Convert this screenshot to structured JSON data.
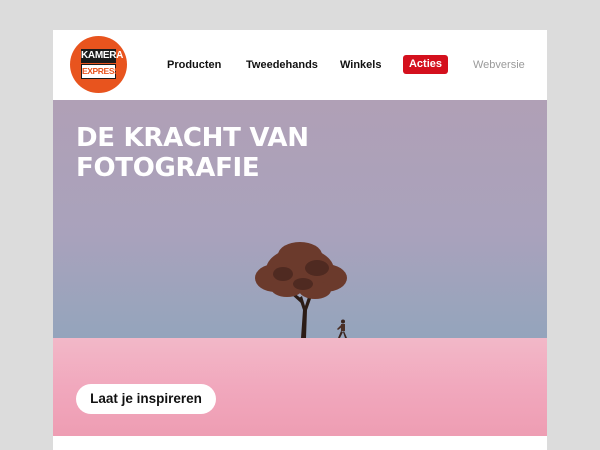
{
  "brand": {
    "logo_line1": "KAMERA",
    "logo_line2": "EXPRESS",
    "accent": "#e8541e"
  },
  "nav": {
    "items": [
      {
        "label": "Producten"
      },
      {
        "label": "Tweedehands"
      },
      {
        "label": "Winkels"
      },
      {
        "label": "Acties",
        "highlight_color": "#d4101d"
      },
      {
        "label": "Webversie"
      }
    ]
  },
  "hero": {
    "title_line1": "DE KRACHT VAN",
    "title_line2": "FOTOGRAFIE",
    "cta_label": "Laat je inspireren",
    "sky_color": "#a9a2bc",
    "ground_color": "#f1a8bd"
  },
  "icons": [
    "kamera-express-logo",
    "tree-image",
    "walking-person-image"
  ]
}
